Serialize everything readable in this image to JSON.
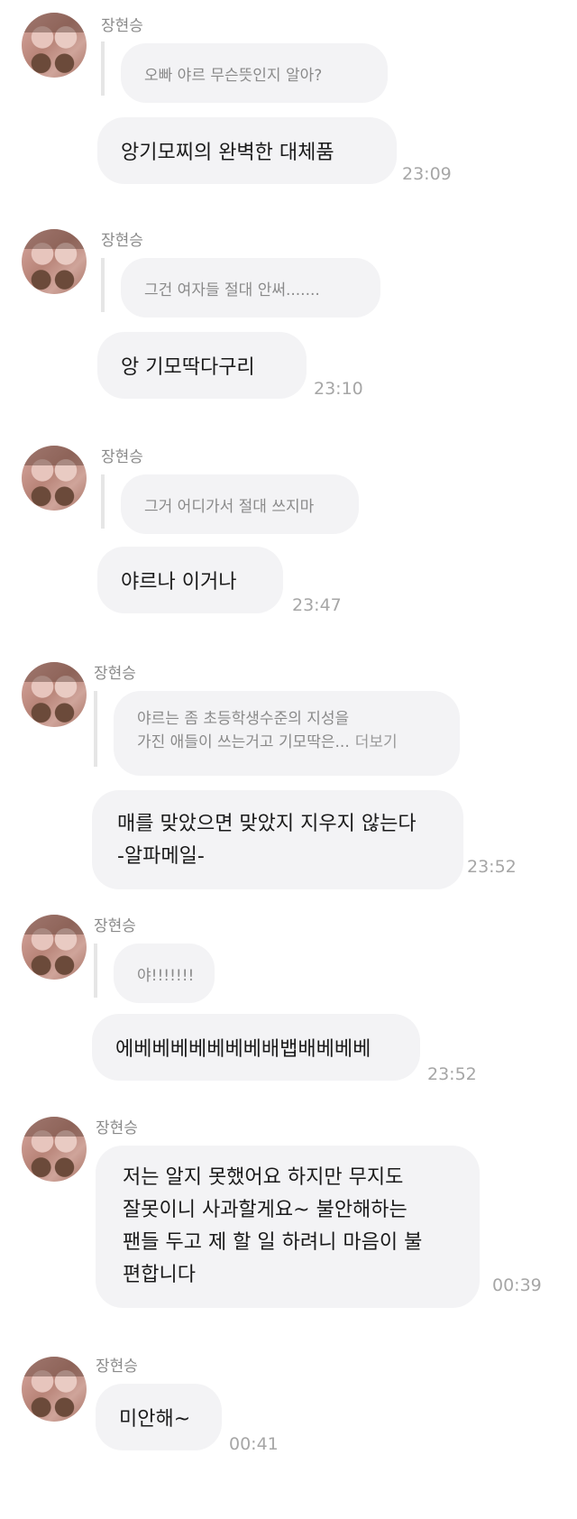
{
  "sender_name": "장현승",
  "avatar_caption": "~~~",
  "messages": [
    {
      "quote": "오빠 야르 무슨뜻인지 알아?",
      "reply": "앙기모찌의 완벽한 대체품",
      "time": "23:09"
    },
    {
      "quote": "그건 여자들 절대 안써.......",
      "reply": "앙 기모딱다구리",
      "time": "23:10"
    },
    {
      "quote": "그거 어디가서 절대 쓰지마",
      "reply": "야르나 이거나",
      "time": "23:47"
    },
    {
      "quote_lines": [
        "야르는 좀 초등학생수준의 지성을",
        "가진 애들이 쓰는거고 기모딱은..."
      ],
      "quote_more": "더보기",
      "reply_lines": [
        "매를 맞았으면 맞았지 지우지 않는다",
        "-알파메일-"
      ],
      "time": "23:52"
    },
    {
      "quote": "야!!!!!!!",
      "reply": "에베베베베베베베배뱁배베베베",
      "time": "23:52"
    },
    {
      "reply_lines": [
        "저는 알지 못했어요 하지만 무지도",
        "잘못이니 사과할게요~ 불안해하는",
        "팬들 두고 제 할 일 하려니 마음이 불",
        "편합니다"
      ],
      "time": "00:39"
    },
    {
      "reply": "미안해~",
      "time": "00:41"
    }
  ]
}
